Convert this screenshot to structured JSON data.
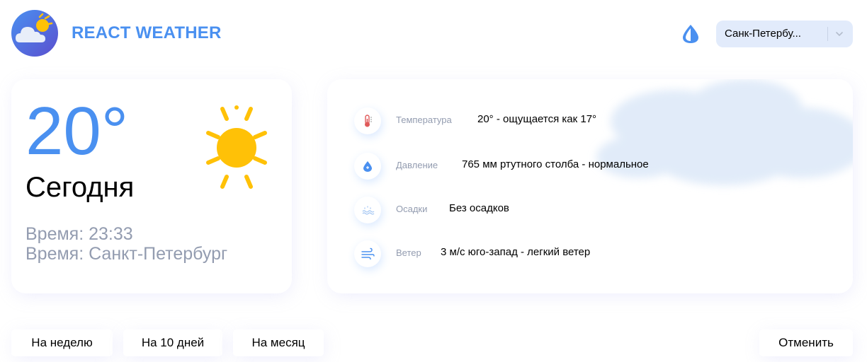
{
  "header": {
    "app_title": "REACT WEATHER",
    "logo_icon": "cloud-sun-logo-icon",
    "theme_icon": "drop-icon",
    "city_select": {
      "value": "Санк-Петербу...",
      "icon": "chevron-down-icon"
    }
  },
  "today": {
    "temperature": "20°",
    "label": "Сегодня",
    "time": "Время: 23:33",
    "city": "Время: Санкт-Петербург",
    "icon": "sun-icon"
  },
  "details": [
    {
      "icon": "thermometer-icon",
      "label": "Температура",
      "value": "20° - ощущается как 17°"
    },
    {
      "icon": "pressure-drop-icon",
      "label": "Давление",
      "value": "765 мм ртутного столба - нормальное"
    },
    {
      "icon": "precipitation-icon",
      "label": "Осадки",
      "value": "Без осадков"
    },
    {
      "icon": "wind-icon",
      "label": "Ветер",
      "value": "3 м/с юго-запад - легкий ветер"
    }
  ],
  "buttons": {
    "week": "На неделю",
    "ten_days": "На 10 дней",
    "month": "На месяц",
    "cancel": "Отменить"
  },
  "colors": {
    "accent": "#4a90f0",
    "muted_text": "#939cb0",
    "select_bg": "#e2ebfb",
    "sun": "#ffc107"
  }
}
